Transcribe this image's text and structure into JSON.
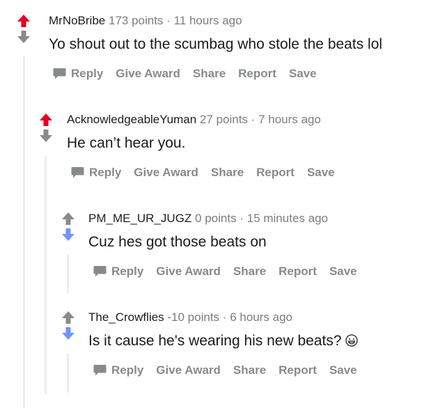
{
  "comments": [
    {
      "author": "MrNoBribe",
      "points": "173 points",
      "sep": "·",
      "time": "11 hours ago",
      "body": "Yo shout out to the scumbag who stole the beats lol",
      "vote_state": "upvoted"
    },
    {
      "author": "AcknowledgeableYuman",
      "points": "27 points",
      "sep": "·",
      "time": "7 hours ago",
      "body": "He can’t hear you.",
      "vote_state": "upvoted"
    },
    {
      "author": "PM_ME_UR_JUGZ",
      "points": "0 points",
      "sep": "·",
      "time": "15 minutes ago",
      "body": "Cuz hes got those beats on",
      "vote_state": "downvoted"
    },
    {
      "author": "The_Crowflies",
      "points": "-10 points",
      "sep": "·",
      "time": "6 hours ago",
      "body": "Is it cause he's wearing his new beats?",
      "vote_state": "downvoted",
      "emoji": "grinning-face-icon"
    }
  ],
  "actions": {
    "reply": "Reply",
    "give_award": "Give Award",
    "share": "Share",
    "report": "Report",
    "save": "Save"
  },
  "colors": {
    "upvote": "#e8001c",
    "downvote": "#7193ff",
    "neutral_arrow": "#8a8a8a",
    "thread_line": "#ededed",
    "meta": "#7c7c7c",
    "action": "#878a8c"
  }
}
